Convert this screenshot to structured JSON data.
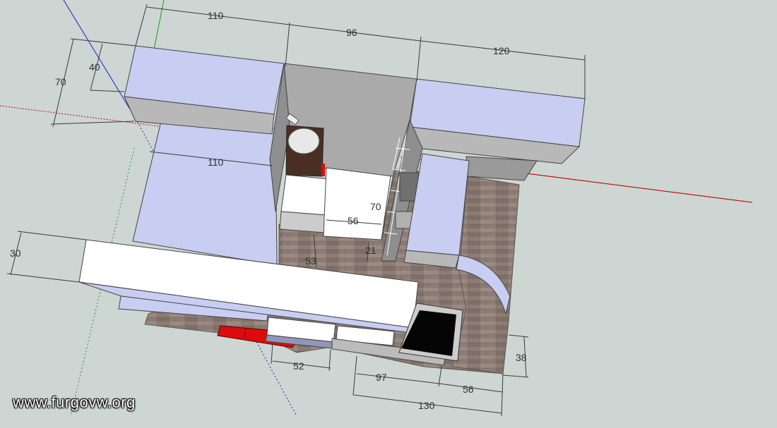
{
  "watermark": "www.furgovw.org",
  "dimensions": {
    "top_left_width": "110",
    "top_middle_width": "96",
    "top_right_width": "120",
    "left_height_outer": "70",
    "left_height_inner": "40",
    "bed_width": "110",
    "shelf_height": "70",
    "counter_width": "56",
    "floor_depth": "53",
    "small_gap": "21",
    "front_height": "30",
    "bottom_right_depth": "38",
    "bottom_seg_a": "52",
    "bottom_seg_b": "97",
    "bottom_seg_c": "56",
    "bottom_total": "130"
  },
  "colors": {
    "background": "#cdd6d2",
    "cabinet_blue": "#c8cdf2",
    "cabinet_side": "#b8b8b8",
    "wood_floor": "#8c7c74",
    "white_panel": "#ffffff",
    "red_item": "#dd0b0b",
    "axis_red": "#c00000",
    "axis_blue": "#1a1acc",
    "axis_green": "#19a019"
  }
}
